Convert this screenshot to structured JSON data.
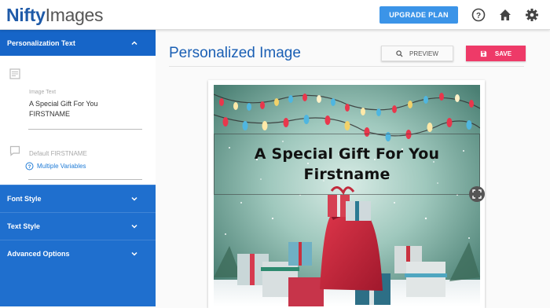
{
  "app": {
    "logo_bold": "Nifty",
    "logo_light": "Images"
  },
  "topbar": {
    "upgrade_label": "UPGRADE PLAN",
    "icons": [
      "help-icon",
      "home-icon",
      "gear-icon"
    ]
  },
  "sidebar": {
    "personalization": {
      "header": "Personalization Text",
      "image_text_label": "Image Text",
      "image_text_line1": "A Special Gift For You",
      "image_text_line2": "FIRSTNAME",
      "default_placeholder": "Default FIRSTNAME",
      "multiple_variables": "Multiple Variables"
    },
    "sections": [
      {
        "label": "Font Style"
      },
      {
        "label": "Text Style"
      },
      {
        "label": "Advanced Options"
      }
    ]
  },
  "main": {
    "title": "Personalized Image",
    "preview_label": "PREVIEW",
    "save_label": "SAVE"
  },
  "image": {
    "line1": "A Special Gift For You",
    "line2": "Firstname"
  },
  "colors": {
    "brand_blue": "#1f6fce",
    "upgrade_blue": "#3b94e8",
    "save_pink": "#ee3a68",
    "title_blue": "#1a5fb4"
  }
}
